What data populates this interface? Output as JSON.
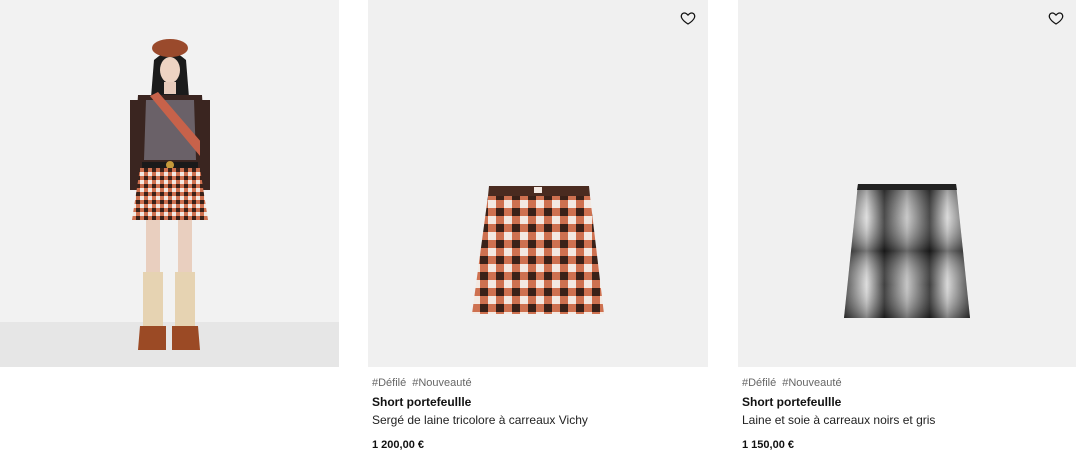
{
  "products": [
    {
      "tags": [
        "#Défilé",
        "#Nouveauté"
      ],
      "name": "Short portefeullle",
      "description": "Sergé de laine tricolore à carreaux Vichy",
      "price": "1 200,00 €"
    },
    {
      "tags": [
        "#Défilé",
        "#Nouveauté"
      ],
      "name": "Short portefeullle",
      "description": "Laine et soie à carreaux noirs et gris",
      "price": "1 150,00 €"
    }
  ],
  "icons": {
    "wishlist": "heart-outline-icon"
  },
  "colors": {
    "background": "#ffffff",
    "image_bg": "#f0f0f0",
    "text": "#1a1a1a",
    "tag_text": "#666666"
  }
}
